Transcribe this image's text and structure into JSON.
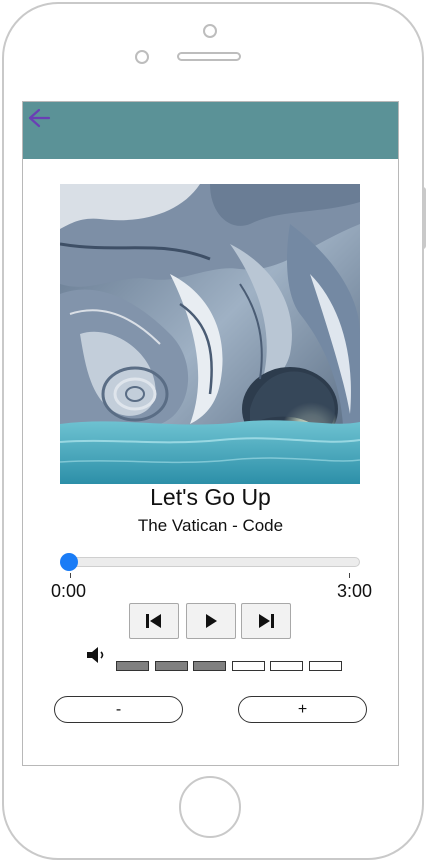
{
  "theme": {
    "appbar_color": "#5b9297",
    "accent_color": "#1a7cf6",
    "back_arrow_color": "#6a3fb5",
    "volume_filled_color": "#808080"
  },
  "app_bar": {
    "back_icon": "arrow-left-icon"
  },
  "track": {
    "title": "Let's Go Up",
    "artist": "The Vatican - Code",
    "position_fraction": 0.0,
    "current_time": "0:00",
    "total_time": "3:00"
  },
  "controls": {
    "previous_icon": "skip-previous-icon",
    "play_icon": "play-icon",
    "next_icon": "skip-next-icon"
  },
  "volume": {
    "icon": "speaker-icon",
    "level": 3,
    "segments": 6
  },
  "buttons": {
    "minus_label": "-",
    "plus_label": "+"
  }
}
